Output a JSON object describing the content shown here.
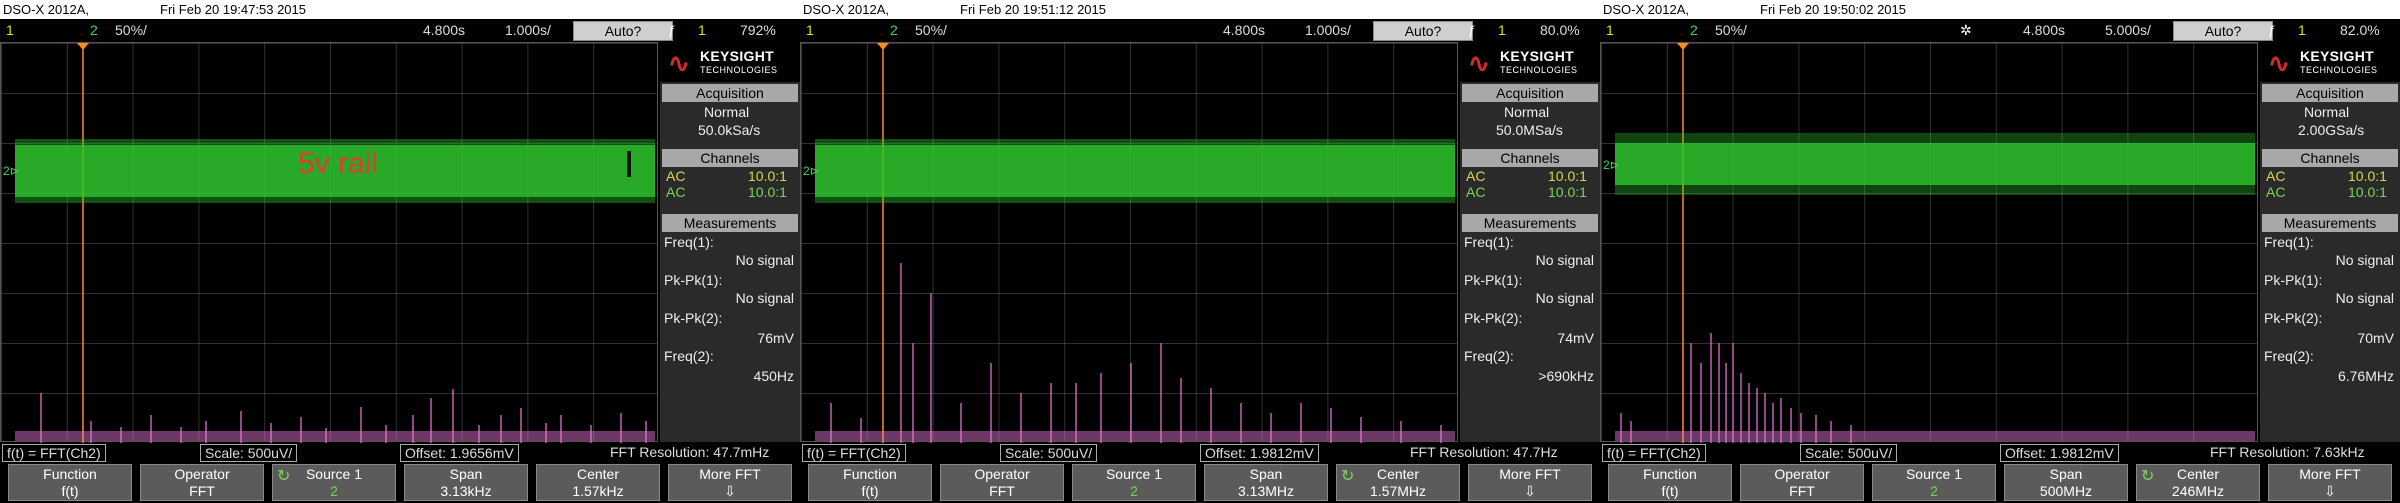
{
  "colors": {
    "ch1": "#e6e600",
    "ch2": "#48d448",
    "math": "#f07de0",
    "cursor": "#ff8c1a",
    "annotation": "#e33b2e"
  },
  "scopes": [
    {
      "header": {
        "model": "DSO-X 2012A,",
        "datetime": "Fri Feb 20 19:47:53 2015"
      },
      "status": {
        "ch1": "1",
        "ch2": "2",
        "ch2_scale": "50%/",
        "delay": "4.800s",
        "timebase": "1.000s/",
        "trigger": "Auto?",
        "trig_ch": "1",
        "trig_level": "792%"
      },
      "annotation": "5v rail",
      "acquisition": {
        "title": "Acquisition",
        "mode": "Normal",
        "rate": "50.0kSa/s"
      },
      "channels": {
        "title": "Channels",
        "rows": [
          {
            "coupling": "AC",
            "probe": "10.0:1"
          },
          {
            "coupling": "AC",
            "probe": "10.0:1"
          }
        ]
      },
      "measurements": {
        "title": "Measurements",
        "items": [
          {
            "label": "Freq(1):",
            "value": "No signal"
          },
          {
            "label": "Pk-Pk(1):",
            "value": "No signal"
          },
          {
            "label": "Pk-Pk(2):",
            "value": "76mV"
          },
          {
            "label": "Freq(2):",
            "value": "450Hz"
          }
        ]
      },
      "bottom": {
        "function": "f(t) = FFT(Ch2)",
        "scale": "Scale: 500uV/",
        "offset": "Offset: 1.9656mV",
        "resolution": "FFT Resolution: 47.7mHz"
      },
      "softkeys": [
        {
          "title": "Function",
          "value": "f(t)"
        },
        {
          "title": "Operator",
          "value": "FFT"
        },
        {
          "title": "Source 1",
          "value": "2"
        },
        {
          "title": "Span",
          "value": "3.13kHz"
        },
        {
          "title": "Center",
          "value": "1.57kHz"
        },
        {
          "title": "More FFT",
          "value": "⇩"
        }
      ]
    },
    {
      "header": {
        "model": "DSO-X 2012A,",
        "datetime": "Fri Feb 20 19:51:12 2015"
      },
      "status": {
        "ch1": "1",
        "ch2": "2",
        "ch2_scale": "50%/",
        "delay": "4.800s",
        "timebase": "1.000s/",
        "trigger": "Auto?",
        "trig_ch": "1",
        "trig_level": "80.0%"
      },
      "annotation": "",
      "acquisition": {
        "title": "Acquisition",
        "mode": "Normal",
        "rate": "50.0MSa/s"
      },
      "channels": {
        "title": "Channels",
        "rows": [
          {
            "coupling": "AC",
            "probe": "10.0:1"
          },
          {
            "coupling": "AC",
            "probe": "10.0:1"
          }
        ]
      },
      "measurements": {
        "title": "Measurements",
        "items": [
          {
            "label": "Freq(1):",
            "value": "No signal"
          },
          {
            "label": "Pk-Pk(1):",
            "value": "No signal"
          },
          {
            "label": "Pk-Pk(2):",
            "value": "74mV"
          },
          {
            "label": "Freq(2):",
            "value": ">690kHz"
          }
        ]
      },
      "bottom": {
        "function": "f(t) = FFT(Ch2)",
        "scale": "Scale: 500uV/",
        "offset": "Offset: 1.9812mV",
        "resolution": "FFT Resolution: 47.7Hz"
      },
      "softkeys": [
        {
          "title": "Function",
          "value": "f(t)"
        },
        {
          "title": "Operator",
          "value": "FFT"
        },
        {
          "title": "Source 1",
          "value": "2"
        },
        {
          "title": "Span",
          "value": "3.13MHz"
        },
        {
          "title": "Center",
          "value": "1.57MHz"
        },
        {
          "title": "More FFT",
          "value": "⇩"
        }
      ]
    },
    {
      "header": {
        "model": "DSO-X 2012A,",
        "datetime": "Fri Feb 20 19:50:02 2015"
      },
      "status": {
        "ch1": "1",
        "ch2": "2",
        "ch2_scale": "50%/",
        "delay": "4.800s",
        "timebase": "5.000s/",
        "trigger": "Auto?",
        "trig_ch": "1",
        "trig_level": "82.0%"
      },
      "annotation": "",
      "acquisition": {
        "title": "Acquisition",
        "mode": "Normal",
        "rate": "2.00GSa/s"
      },
      "channels": {
        "title": "Channels",
        "rows": [
          {
            "coupling": "AC",
            "probe": "10.0:1"
          },
          {
            "coupling": "AC",
            "probe": "10.0:1"
          }
        ]
      },
      "measurements": {
        "title": "Measurements",
        "items": [
          {
            "label": "Freq(1):",
            "value": "No signal"
          },
          {
            "label": "Pk-Pk(1):",
            "value": "No signal"
          },
          {
            "label": "Pk-Pk(2):",
            "value": "70mV"
          },
          {
            "label": "Freq(2):",
            "value": "6.76MHz"
          }
        ]
      },
      "bottom": {
        "function": "f(t) = FFT(Ch2)",
        "scale": "Scale: 500uV/",
        "offset": "Offset: 1.9812mV",
        "resolution": "FFT Resolution: 7.63kHz"
      },
      "softkeys": [
        {
          "title": "Function",
          "value": "f(t)"
        },
        {
          "title": "Operator",
          "value": "FFT"
        },
        {
          "title": "Source 1",
          "value": "2"
        },
        {
          "title": "Span",
          "value": "500MHz"
        },
        {
          "title": "Center",
          "value": "246MHz"
        },
        {
          "title": "More FFT",
          "value": "⇩"
        }
      ]
    }
  ],
  "brand": {
    "name": "KEYSIGHT",
    "sub": "TECHNOLOGIES"
  }
}
